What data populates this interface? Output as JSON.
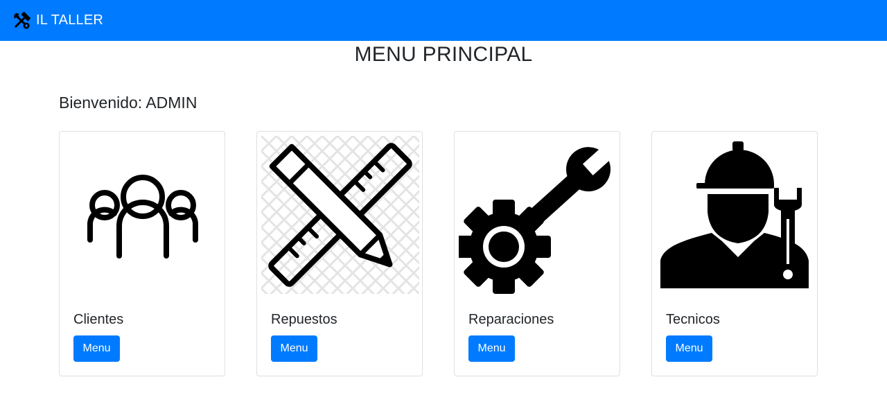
{
  "navbar": {
    "brand_icon": "tools-icon",
    "brand_text": "IL TALLER",
    "background": "#007bff"
  },
  "page": {
    "title": "MENU PRINCIPAL",
    "welcome": "Bienvenido: ADMIN"
  },
  "cards": [
    {
      "icon": "users-icon",
      "title": "Clientes",
      "button_label": "Menu"
    },
    {
      "icon": "pencil-ruler-icon",
      "title": "Repuestos",
      "button_label": "Menu"
    },
    {
      "icon": "gear-wrench-icon",
      "title": "Reparaciones",
      "button_label": "Menu"
    },
    {
      "icon": "technician-icon",
      "title": "Tecnicos",
      "button_label": "Menu"
    }
  ],
  "colors": {
    "primary": "#007bff",
    "text": "#212529"
  }
}
